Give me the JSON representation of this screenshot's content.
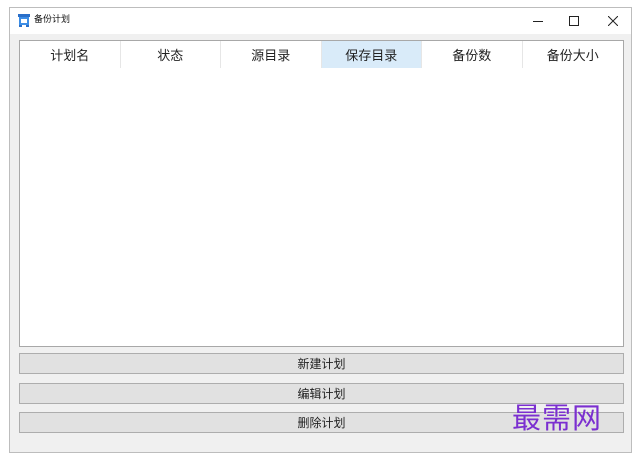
{
  "window": {
    "title": "备份计划",
    "icon": "app-window-icon",
    "controls": [
      "minimize-icon",
      "maximize-icon",
      "close-icon"
    ]
  },
  "table": {
    "columns": [
      {
        "label": "计划名",
        "selected": false
      },
      {
        "label": "状态",
        "selected": false
      },
      {
        "label": "源目录",
        "selected": false
      },
      {
        "label": "保存目录",
        "selected": true
      },
      {
        "label": "备份数",
        "selected": false
      },
      {
        "label": "备份大小",
        "selected": false
      }
    ],
    "rows": []
  },
  "buttons": {
    "new": "新建计划",
    "edit": "编辑计划",
    "delete": "删除计划"
  },
  "watermark": {
    "text": "最需网",
    "color": "#7b2fd0"
  },
  "colors": {
    "header_selected": "#d9ebf9",
    "button_bg": "#e1e1e1",
    "window_bg": "#f0f0f0"
  }
}
